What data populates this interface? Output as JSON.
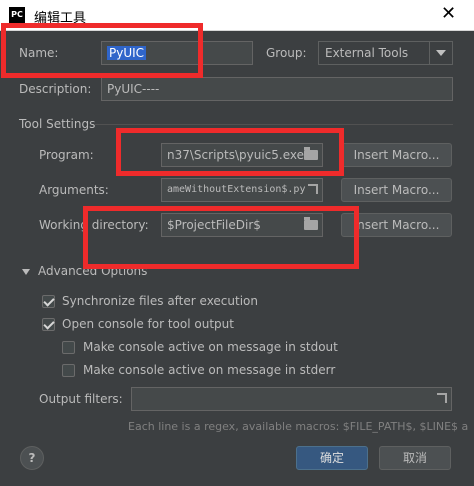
{
  "window": {
    "title": "编辑工具",
    "app_icon": "PC",
    "close": "✕"
  },
  "name": {
    "label": "Name:",
    "value": "PyUIC"
  },
  "group": {
    "label": "Group:",
    "value": "External Tools"
  },
  "description": {
    "label": "Description:",
    "value": "PyUIC----"
  },
  "tool_settings": {
    "heading": "Tool Settings",
    "program": {
      "label": "Program:",
      "value": "n37\\Scripts\\pyuic5.exe",
      "button": "Insert Macro..."
    },
    "arguments": {
      "label": "Arguments:",
      "value": "ameWithoutExtension$.py",
      "button": "Insert Macro..."
    },
    "working_dir": {
      "label": "Working directory:",
      "value": "$ProjectFileDir$",
      "button": "Insert Macro..."
    }
  },
  "advanced": {
    "heading": "Advanced Options",
    "options": [
      {
        "label": "Synchronize files after execution",
        "checked": true
      },
      {
        "label": "Open console for tool output",
        "checked": true
      },
      {
        "label": "Make console active on message in stdout",
        "checked": false
      },
      {
        "label": "Make console active on message in stderr",
        "checked": false
      }
    ],
    "output_filters": {
      "label": "Output filters:",
      "value": ""
    },
    "hint": "Each line is a regex, available macros: $FILE_PATH$, $LINE$ a"
  },
  "footer": {
    "help": "?",
    "ok": "确定",
    "cancel": "取消"
  },
  "colors": {
    "annotation": "#ef2b2b",
    "primary": "#365880",
    "background": "#3c3f41"
  }
}
